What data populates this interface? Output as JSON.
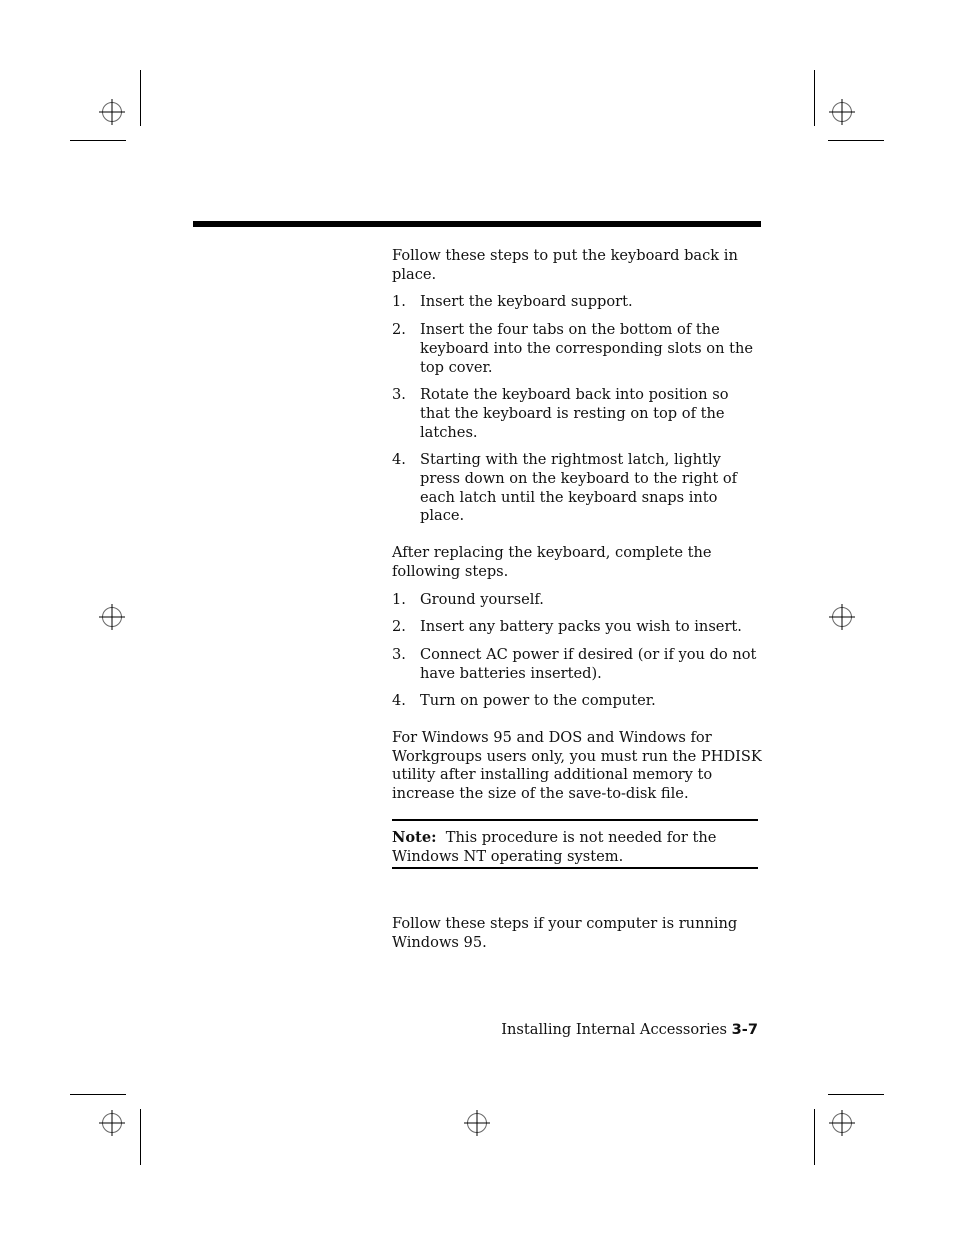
{
  "intro": "Follow these steps to put the keyboard back in place.",
  "keyboard_steps": [
    {
      "num": "1.",
      "text": "Insert the keyboard support."
    },
    {
      "num": "2.",
      "text": "Insert the four tabs on the bottom of the keyboard into the corresponding slots on the top cover."
    },
    {
      "num": "3.",
      "text": "Rotate the keyboard back into position so that the keyboard is resting on top of the latches."
    },
    {
      "num": "4.",
      "text": "Starting with the rightmost latch, lightly press down on the keyboard to the right of each latch until the keyboard snaps into place."
    }
  ],
  "after_intro": "After replacing the keyboard, complete the following steps.",
  "after_steps": [
    {
      "num": "1.",
      "text": "Ground yourself."
    },
    {
      "num": "2.",
      "text": "Insert any battery packs you wish to insert."
    },
    {
      "num": "3.",
      "text": "Connect AC power if desired (or if you do not have batteries inserted)."
    },
    {
      "num": "4.",
      "text": "Turn on power to the computer."
    }
  ],
  "phdisk_paragraph": "For Windows 95 and DOS and Windows for Workgroups users only, you must run the PHDISK utility after installing additional memory to increase the size of the save-to-disk file.",
  "note": {
    "label": "Note:",
    "text": "This procedure is not needed for the Windows NT operating system."
  },
  "win95_paragraph": "Follow these steps if your computer is running Windows 95.",
  "footer": {
    "chapter": "Installing Internal Accessories",
    "page": "3-7"
  }
}
